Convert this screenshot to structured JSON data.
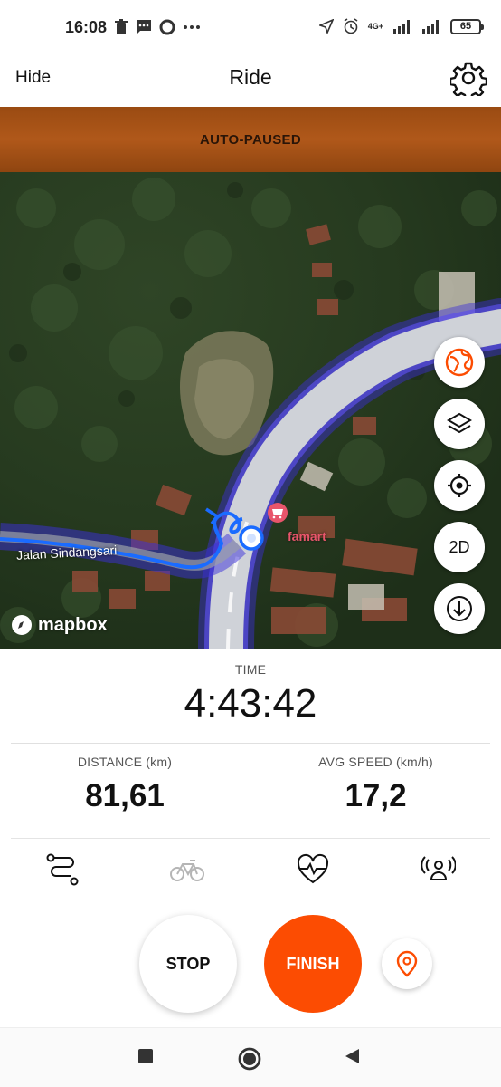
{
  "status_bar": {
    "time": "16:08",
    "network": "4G+",
    "battery": "65"
  },
  "header": {
    "hide_label": "Hide",
    "title": "Ride",
    "settings_icon": "gear-icon"
  },
  "banner": {
    "text": "AUTO-PAUSED"
  },
  "map": {
    "street_name": "Jalan Sindangsari",
    "poi_name": "famart",
    "attribution": "mapbox",
    "buttons": [
      {
        "name": "globe-icon",
        "accent": "#fc4c02"
      },
      {
        "name": "layers-icon"
      },
      {
        "name": "location-target-icon"
      },
      {
        "name": "2d-toggle",
        "label": "2D"
      },
      {
        "name": "download-icon"
      }
    ],
    "colors": {
      "route": "#1a6bff",
      "route_glow": "#3b2fd9",
      "poi": "#e8556b"
    }
  },
  "stats": {
    "time_label": "TIME",
    "time_value": "4:43:42",
    "distance_label": "DISTANCE (km)",
    "distance_value": "81,61",
    "speed_label": "AVG SPEED (km/h)",
    "speed_value": "17,2"
  },
  "tabs": [
    {
      "name": "route-icon"
    },
    {
      "name": "bike-icon"
    },
    {
      "name": "heart-rate-icon"
    },
    {
      "name": "sensor-icon"
    }
  ],
  "actions": {
    "stop_label": "STOP",
    "finish_label": "FINISH",
    "beacon_icon": "location-pin-icon",
    "accent": "#fc4c02"
  },
  "nav": {
    "buttons": [
      "recents-square-icon",
      "home-circle-icon",
      "back-triangle-icon"
    ]
  }
}
